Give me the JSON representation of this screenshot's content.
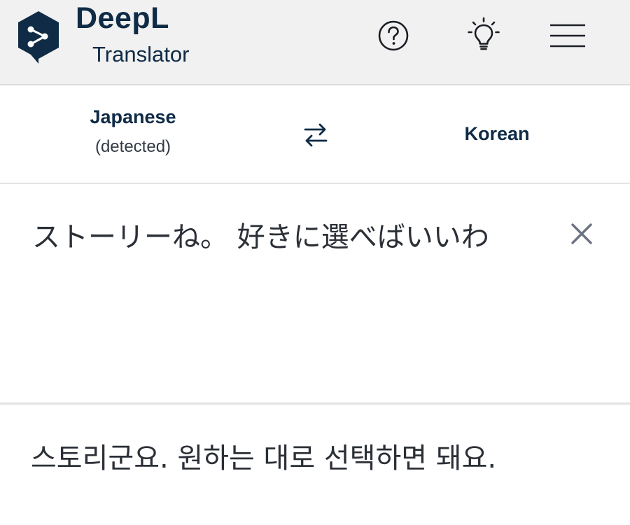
{
  "header": {
    "brand_name": "DeepL",
    "brand_sub": "Translator",
    "icons": {
      "logo": "deepl-logo-icon",
      "help": "help-circle-icon",
      "tips": "lightbulb-icon",
      "menu": "hamburger-menu-icon"
    }
  },
  "language_bar": {
    "source_language": "Japanese",
    "source_detected": "(detected)",
    "target_language": "Korean",
    "swap_icon": "swap-arrows-icon"
  },
  "source": {
    "text": "ストーリーね。 好きに選べばいいわ",
    "clear_icon": "close-icon"
  },
  "target": {
    "text": "스토리군요. 원하는 대로 선택하면 돼요."
  },
  "colors": {
    "brand_navy": "#0f2b46",
    "header_bg": "#f1f1f1",
    "text": "#2b2f36",
    "icon_gray": "#6b7280"
  }
}
